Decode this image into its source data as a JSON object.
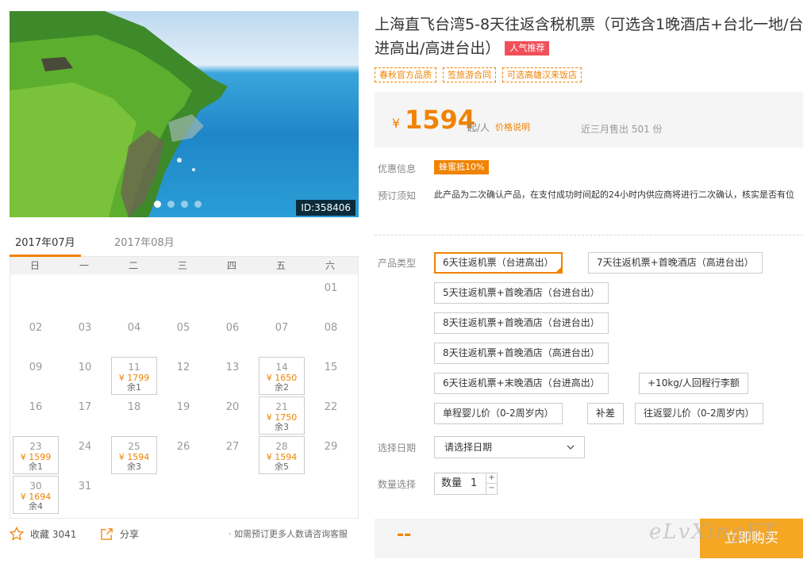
{
  "hero": {
    "id_label": "ID:358406",
    "dots": 4,
    "active_dot": 0
  },
  "months": {
    "tabs": [
      "2017年07月",
      "2017年08月"
    ],
    "active": 0
  },
  "calendar": {
    "weekdays": [
      "日",
      "一",
      "二",
      "三",
      "四",
      "五",
      "六"
    ],
    "days": [
      {
        "d": "01",
        "col": 6,
        "row": 0
      },
      {
        "d": "02",
        "col": 0,
        "row": 1
      },
      {
        "d": "03",
        "col": 1,
        "row": 1
      },
      {
        "d": "04",
        "col": 2,
        "row": 1
      },
      {
        "d": "05",
        "col": 3,
        "row": 1
      },
      {
        "d": "06",
        "col": 4,
        "row": 1
      },
      {
        "d": "07",
        "col": 5,
        "row": 1
      },
      {
        "d": "08",
        "col": 6,
        "row": 1
      },
      {
        "d": "09",
        "col": 0,
        "row": 2
      },
      {
        "d": "10",
        "col": 1,
        "row": 2
      },
      {
        "d": "11",
        "col": 2,
        "row": 2,
        "price": "¥ 1799",
        "left": "余1"
      },
      {
        "d": "12",
        "col": 3,
        "row": 2
      },
      {
        "d": "13",
        "col": 4,
        "row": 2
      },
      {
        "d": "14",
        "col": 5,
        "row": 2,
        "price": "¥ 1650",
        "left": "余2"
      },
      {
        "d": "15",
        "col": 6,
        "row": 2
      },
      {
        "d": "16",
        "col": 0,
        "row": 3
      },
      {
        "d": "17",
        "col": 1,
        "row": 3
      },
      {
        "d": "18",
        "col": 2,
        "row": 3
      },
      {
        "d": "19",
        "col": 3,
        "row": 3
      },
      {
        "d": "20",
        "col": 4,
        "row": 3
      },
      {
        "d": "21",
        "col": 5,
        "row": 3,
        "price": "¥ 1750",
        "left": "余3"
      },
      {
        "d": "22",
        "col": 6,
        "row": 3
      },
      {
        "d": "23",
        "col": 0,
        "row": 4,
        "price": "¥ 1599",
        "left": "余1"
      },
      {
        "d": "24",
        "col": 1,
        "row": 4
      },
      {
        "d": "25",
        "col": 2,
        "row": 4,
        "price": "¥ 1594",
        "left": "余3"
      },
      {
        "d": "26",
        "col": 3,
        "row": 4
      },
      {
        "d": "27",
        "col": 4,
        "row": 4
      },
      {
        "d": "28",
        "col": 5,
        "row": 4,
        "price": "¥ 1594",
        "left": "余5"
      },
      {
        "d": "29",
        "col": 6,
        "row": 4
      },
      {
        "d": "30",
        "col": 0,
        "row": 5,
        "price": "¥ 1694",
        "left": "余4"
      },
      {
        "d": "31",
        "col": 1,
        "row": 5
      }
    ]
  },
  "footer_left": {
    "favorite_label": "收藏 3041",
    "share_label": "分享",
    "consult": "· 如需预订更多人数请咨询客服"
  },
  "product": {
    "title": "上海直飞台湾5-8天往返含税机票（可选含1晚酒店+台北一地/台进高出/高进台出）",
    "hot_tag": "人气推荐",
    "tags": [
      "春秋官方品质",
      "签旅游合同",
      "可选高雄汉来饭店"
    ]
  },
  "price": {
    "currency": "¥",
    "value": "1594",
    "unit": "起/人",
    "explain": "价格说明",
    "sold": "近三月售出 501 份"
  },
  "info": {
    "discount_label": "优惠信息",
    "discount": "蜂蜜抵10%",
    "notice_label": "预订须知",
    "notice": "此产品为二次确认产品，在支付成功时间起的24小时内供应商将进行二次确认，核实是否有位"
  },
  "options": {
    "label": "产品类型",
    "items": [
      "6天往返机票（台进高出）",
      "7天往返机票+首晚酒店（高进台出）",
      "5天往返机票+首晚酒店（台进台出）",
      "8天往返机票+首晚酒店（台进台出）",
      "8天往返机票+首晚酒店（高进台出）",
      "6天往返机票+末晚酒店（台进高出）",
      "+10kg/人回程行李额",
      "单程婴儿价（0-2周岁内）",
      "补差",
      "往返婴儿价（0-2周岁内）"
    ],
    "selected": 0
  },
  "date_select": {
    "label": "选择日期",
    "value": "请选择日期"
  },
  "quantity": {
    "label": "数量选择",
    "prefix": "数量",
    "value": "1",
    "plus": "+",
    "minus": "−"
  },
  "bottom": {
    "total": "--",
    "buy_label": "立即购买",
    "watermark": "eLvXingFT"
  },
  "colors": {
    "accent": "#f08300",
    "buy": "#f5a623",
    "hot": "#f0505a"
  }
}
